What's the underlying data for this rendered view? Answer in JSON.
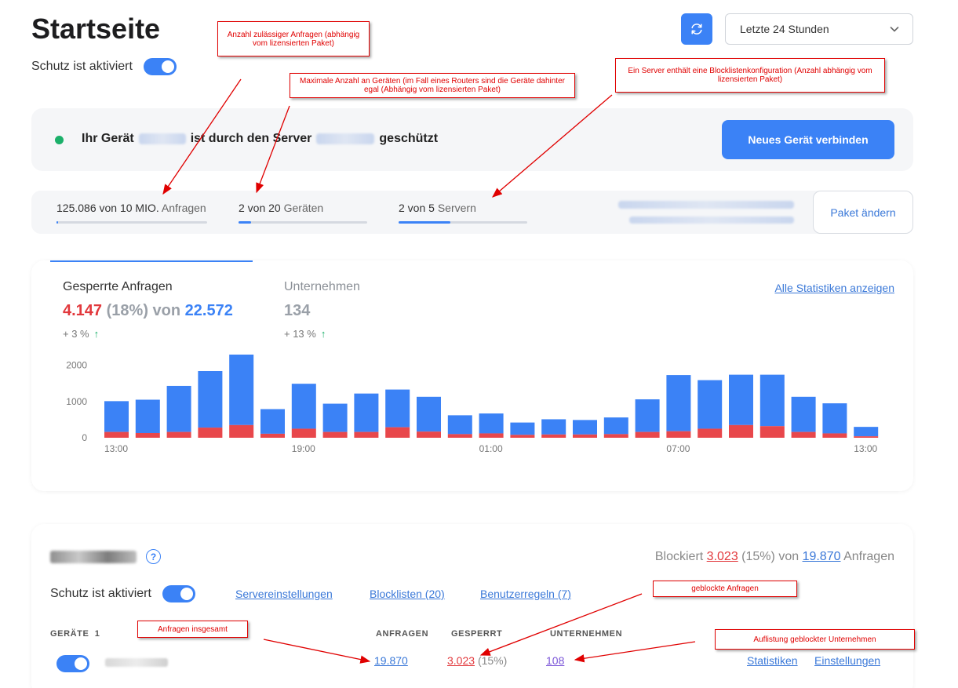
{
  "header": {
    "title": "Startseite",
    "protection_label": "Schutz ist aktiviert",
    "range_selected": "Letzte 24 Stunden"
  },
  "device": {
    "prefix": "Ihr Gerät",
    "middle": "ist durch den Server",
    "suffix": "geschützt",
    "connect_button": "Neues Gerät verbinden"
  },
  "usage": {
    "requests": {
      "value": "125.086 von 10 MIO.",
      "unit": "Anfragen",
      "fill": 0.012
    },
    "devices": {
      "value": "2 von 20",
      "unit": "Geräten",
      "fill": 0.1
    },
    "servers": {
      "value": "2 von 5",
      "unit": "Servern",
      "fill": 0.4
    },
    "change_package": "Paket ändern"
  },
  "stats": {
    "blocked_label": "Gesperrte Anfragen",
    "blocked_count": "4.147",
    "blocked_pct": "(18%)",
    "blocked_of": "von",
    "total": "22.572",
    "blocked_delta": "+ 3 %",
    "companies_label": "Unternehmen",
    "companies_count": "134",
    "companies_delta": "+ 13 %",
    "all_stats_link": "Alle Statistiken anzeigen"
  },
  "chart_data": {
    "type": "bar",
    "stacked": true,
    "categories": [
      "13:00",
      "14:00",
      "15:00",
      "16:00",
      "17:00",
      "18:00",
      "19:00",
      "20:00",
      "21:00",
      "22:00",
      "23:00",
      "00:00",
      "01:00",
      "02:00",
      "03:00",
      "04:00",
      "05:00",
      "06:00",
      "07:00",
      "08:00",
      "09:00",
      "10:00",
      "11:00",
      "12:00",
      "13:00"
    ],
    "tick_labels": [
      "13:00",
      "19:00",
      "01:00",
      "07:00",
      "13:00"
    ],
    "y_ticks": [
      0,
      1000,
      2000
    ],
    "ylim": [
      0,
      2100
    ],
    "series": [
      {
        "color": "#3b82f6",
        "values": [
          850,
          920,
          1270,
          1560,
          2050,
          680,
          1240,
          780,
          1060,
          1040,
          960,
          520,
          550,
          340,
          420,
          400,
          460,
          900,
          1550,
          1340,
          1390,
          1420,
          970,
          830,
          260
        ]
      },
      {
        "color": "#e8474b",
        "values": [
          160,
          130,
          160,
          280,
          350,
          110,
          250,
          160,
          160,
          290,
          170,
          100,
          120,
          80,
          90,
          90,
          100,
          160,
          180,
          250,
          350,
          320,
          160,
          120,
          40
        ]
      }
    ]
  },
  "server": {
    "help_icon": "?",
    "blocked_prefix": "Blockiert",
    "blocked_value": "3.023",
    "blocked_pct": "(15%)",
    "blocked_of": "von",
    "requests_value": "19.870",
    "requests_unit": "Anfragen",
    "protection_label": "Schutz ist aktiviert",
    "links": {
      "settings": "Servereinstellungen",
      "blocklists": "Blocklisten (20)",
      "rules": "Benutzerregeln (7)"
    },
    "columns": {
      "devices": "GERÄTE",
      "devices_count": "1",
      "requests": "ANFRAGEN",
      "blocked": "GESPERRT",
      "companies": "UNTERNEHMEN"
    },
    "row": {
      "requests": "19.870",
      "blocked": "3.023",
      "blocked_pct": "(15%)",
      "companies": "108",
      "stats_link": "Statistiken",
      "settings_link": "Einstellungen"
    }
  },
  "annotations": {
    "note1": "Anzahl zulässiger Anfragen (abhängig vom lizensierten Paket)",
    "note2": "Maximale Anzahl an Geräten (im Fall eines Routers sind die Geräte dahinter egal (Abhängig vom lizensierten Paket)",
    "note3": "Ein Server enthält eine Blocklistenkonfiguration (Anzahl abhängig vom lizensierten Paket)",
    "note4": "geblockte Anfragen",
    "note5": "Anfragen insgesamt",
    "note6": "Auflistung geblockter Unternehmen"
  },
  "colors": {
    "accent": "#3b82f6",
    "danger": "#e8474b",
    "success": "#1bb06a",
    "annotation": "#e00000"
  }
}
